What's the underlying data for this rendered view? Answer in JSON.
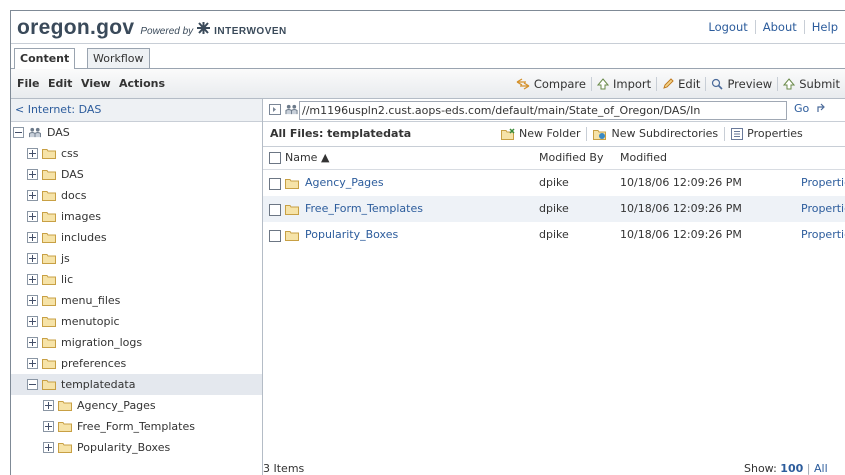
{
  "header": {
    "logo": "oregon.gov",
    "powered_by": "Powered by",
    "vendor": "INTERWOVEN",
    "links": [
      "Logout",
      "About",
      "Help"
    ]
  },
  "tabs": [
    "Content",
    "Workflow"
  ],
  "menubar": {
    "menus": [
      "File",
      "Edit",
      "View",
      "Actions"
    ],
    "actions": [
      "Compare",
      "Import",
      "Edit",
      "Preview",
      "Submit"
    ]
  },
  "left": {
    "back_link": "< Internet: DAS",
    "root": "DAS",
    "items": [
      "css",
      "DAS",
      "docs",
      "images",
      "includes",
      "js",
      "lic",
      "menu_files",
      "menutopic",
      "migration_logs",
      "preferences",
      "templatedata"
    ],
    "children": [
      "Agency_Pages",
      "Free_Form_Templates",
      "Popularity_Boxes"
    ]
  },
  "address": {
    "path": "//m1196uspln2.cust.aops-eds.com/default/main/State_of_Oregon/DAS/In",
    "go_label": "Go"
  },
  "files": {
    "title": "All Files: templatedata",
    "actions": [
      "New Folder",
      "New Subdirectories",
      "Properties"
    ],
    "columns": {
      "name": "Name ▲",
      "modified_by": "Modified By",
      "modified": "Modified"
    },
    "rows": [
      {
        "name": "Agency_Pages",
        "modified_by": "dpike",
        "modified": "10/18/06 12:09:26 PM",
        "link": "Properties"
      },
      {
        "name": "Free_Form_Templates",
        "modified_by": "dpike",
        "modified": "10/18/06 12:09:26 PM",
        "link": "Properties"
      },
      {
        "name": "Popularity_Boxes",
        "modified_by": "dpike",
        "modified": "10/18/06 12:09:26 PM",
        "link": "Properties"
      }
    ],
    "count": "3 Items",
    "show_label": "Show:",
    "show_value": "100",
    "show_all": "All"
  },
  "colors": {
    "link": "#2c5c9c",
    "selected_row": "#e4e8ee",
    "alt_row": "#eef2f7",
    "folder": "#e8b84a"
  }
}
